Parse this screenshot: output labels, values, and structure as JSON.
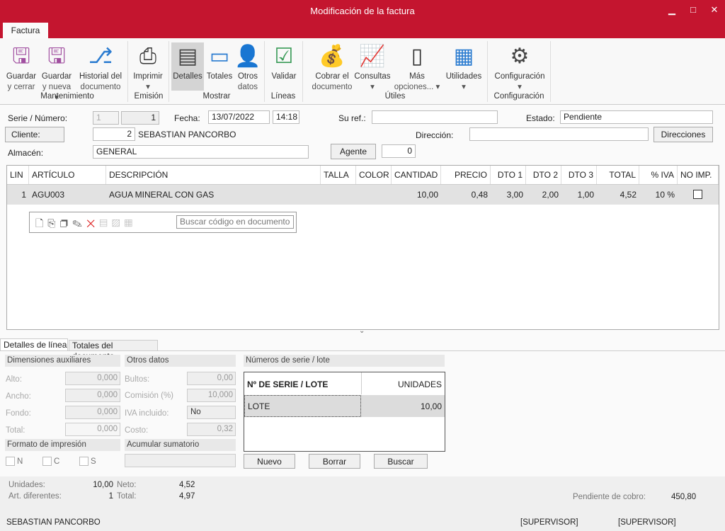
{
  "window": {
    "title": "Modificación de la factura",
    "minimize": "▁",
    "maximize": "□",
    "close": "✕"
  },
  "ribbon": {
    "tab": "Factura",
    "buttons": [
      {
        "l1": "Guardar",
        "l2": "y cerrar",
        "icon": "save-close-icon"
      },
      {
        "l1": "Guardar",
        "l2": "y nueva ▾",
        "icon": "save-new-icon"
      },
      {
        "l1": "Historial del",
        "l2": "documento",
        "icon": "history-icon"
      },
      {
        "l1": "Imprimir",
        "l2": "▾",
        "icon": "printer-icon"
      },
      {
        "l1": "Detalles",
        "l2": "",
        "icon": "details-icon"
      },
      {
        "l1": "Totales",
        "l2": "",
        "icon": "totals-icon"
      },
      {
        "l1": "Otros",
        "l2": "datos",
        "icon": "other-data-icon"
      },
      {
        "l1": "Validar",
        "l2": "",
        "icon": "validate-icon"
      },
      {
        "l1": "Cobrar el",
        "l2": "documento",
        "icon": "collect-icon"
      },
      {
        "l1": "Consultas",
        "l2": "▾",
        "icon": "queries-icon"
      },
      {
        "l1": "Más",
        "l2": "opciones... ▾",
        "icon": "mobile-icon"
      },
      {
        "l1": "Utilidades",
        "l2": "▾",
        "icon": "calculator-icon"
      },
      {
        "l1": "Configuración",
        "l2": "▾",
        "icon": "gear-icon"
      }
    ],
    "groups": [
      "Mantenimiento",
      "Emisión",
      "Mostrar",
      "Líneas",
      "Útiles",
      "Configuración"
    ]
  },
  "form": {
    "serie_label": "Serie / Número:",
    "serie": "1",
    "numero": "1",
    "fecha_label": "Fecha:",
    "fecha": "13/07/2022",
    "hora": "14:18",
    "suref_label": "Su ref.:",
    "suref": "",
    "estado_label": "Estado:",
    "estado": "Pendiente",
    "cliente_label": "Cliente:",
    "cliente_code": "2",
    "cliente_name": "SEBASTIAN PANCORBO",
    "direccion_label": "Dirección:",
    "direccion": "",
    "direcciones": "Direcciones",
    "almacen_label": "Almacén:",
    "almacen": "GENERAL",
    "agente": "Agente",
    "agente_value": "0"
  },
  "grid": {
    "columns": [
      "LIN",
      "ARTÍCULO",
      "DESCRIPCIÓN",
      "TALLA",
      "COLOR",
      "CANTIDAD",
      "PRECIO",
      "DTO 1",
      "DTO 2",
      "DTO 3",
      "TOTAL",
      "% IVA",
      "NO IMP."
    ],
    "rows": [
      {
        "lin": "1",
        "articulo": "AGU003",
        "descripcion": "AGUA MINERAL CON GAS",
        "talla": "",
        "color": "",
        "cantidad": "10,00",
        "precio": "0,48",
        "dto1": "3,00",
        "dto2": "2,00",
        "dto3": "1,00",
        "total": "4,52",
        "iva": "10 %",
        "noimp": false
      }
    ],
    "search_placeholder": "Buscar código en documento"
  },
  "bottom_tabs": [
    "Detalles de línea",
    "Totales del documento"
  ],
  "details": {
    "dim_title": "Dimensiones auxiliares",
    "alto_label": "Alto:",
    "alto": "0,000",
    "ancho_label": "Ancho:",
    "ancho": "0,000",
    "fondo_label": "Fondo:",
    "fondo": "0,000",
    "total_label": "Total:",
    "total": "0,000",
    "otros_title": "Otros datos",
    "bultos_label": "Bultos:",
    "bultos": "0,00",
    "comision_label": "Comisión (%)",
    "comision": "10,000",
    "iva_label": "IVA incluido:",
    "iva": "No",
    "costo_label": "Costo:",
    "costo": "0,32",
    "formato_title": "Formato de impresión",
    "fmt": [
      "N",
      "C",
      "S"
    ],
    "acumular_title": "Acumular sumatorio",
    "serie_title": "Números de serie / lote",
    "serie_cols": [
      "Nº DE SERIE / LOTE",
      "UNIDADES"
    ],
    "serie_rows": [
      {
        "lote": "LOTE",
        "unidades": "10,00"
      }
    ],
    "nuevo": "Nuevo",
    "borrar": "Borrar",
    "buscar": "Buscar"
  },
  "footer": {
    "unidades_label": "Unidades:",
    "unidades": "10,00",
    "art_label": "Art. diferentes:",
    "art": "1",
    "neto_label": "Neto:",
    "neto": "4,52",
    "total_label": "Total:",
    "total": "4,97",
    "pendiente_label": "Pendiente de cobro:",
    "pendiente": "450,80",
    "cliente": "SEBASTIAN PANCORBO",
    "user1": "[SUPERVISOR]",
    "user2": "[SUPERVISOR]"
  }
}
